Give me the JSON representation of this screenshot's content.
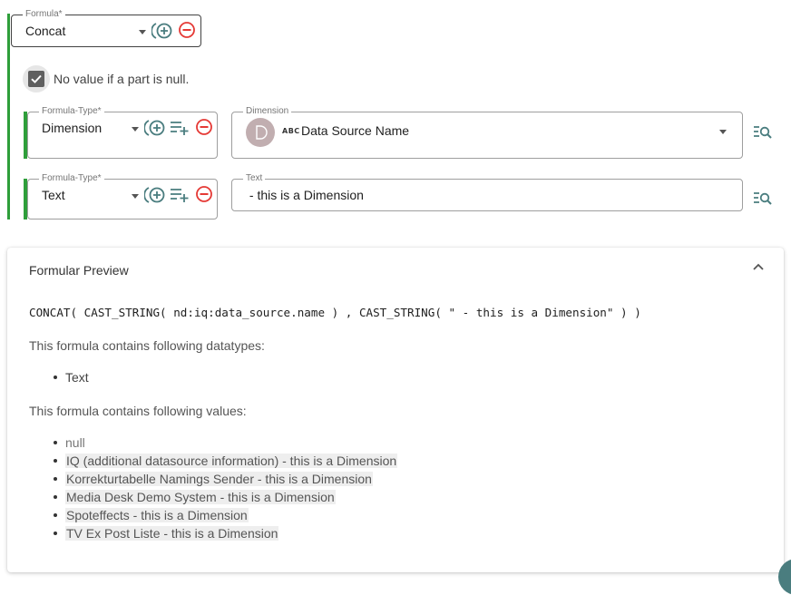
{
  "formula": {
    "label": "Formula*",
    "value": "Concat"
  },
  "null_option": {
    "checked": true,
    "label": "No value if a part is null."
  },
  "parts": [
    {
      "type_label": "Formula-Type*",
      "type_value": "Dimension",
      "value_label": "Dimension",
      "value_type_badge": "ABC",
      "value": "Data Source Name"
    },
    {
      "type_label": "Formula-Type*",
      "type_value": "Text",
      "value_label": "Text",
      "value": " - this is a Dimension"
    }
  ],
  "preview": {
    "title": "Formular Preview",
    "expanded": true,
    "formula_text": "CONCAT( CAST_STRING( nd:iq:data_source.name ) , CAST_STRING( \" - this is a Dimension\" ) )",
    "datatypes_heading": "This formula contains following datatypes:",
    "datatypes": [
      "Text"
    ],
    "values_heading": "This formula contains following values:",
    "values": [
      "null",
      "IQ (additional datasource information) - this is a Dimension",
      "Korrekturtabelle Namings Sender - this is a Dimension",
      "Media Desk Demo System - this is a Dimension",
      "Spoteffects - this is a Dimension",
      "TV Ex Post Liste - this is a Dimension"
    ]
  },
  "colors": {
    "accent_green": "#2e9e3a",
    "icon_teal": "#4a7d7f",
    "remove_red": "#e53935",
    "avatar": "#c1aeb0"
  },
  "icons": {
    "add": "circle-plus-icon",
    "remove": "circle-minus-icon",
    "add_part": "playlist-add-icon",
    "browse": "list-search-icon",
    "collapse": "chevron-up-icon"
  }
}
